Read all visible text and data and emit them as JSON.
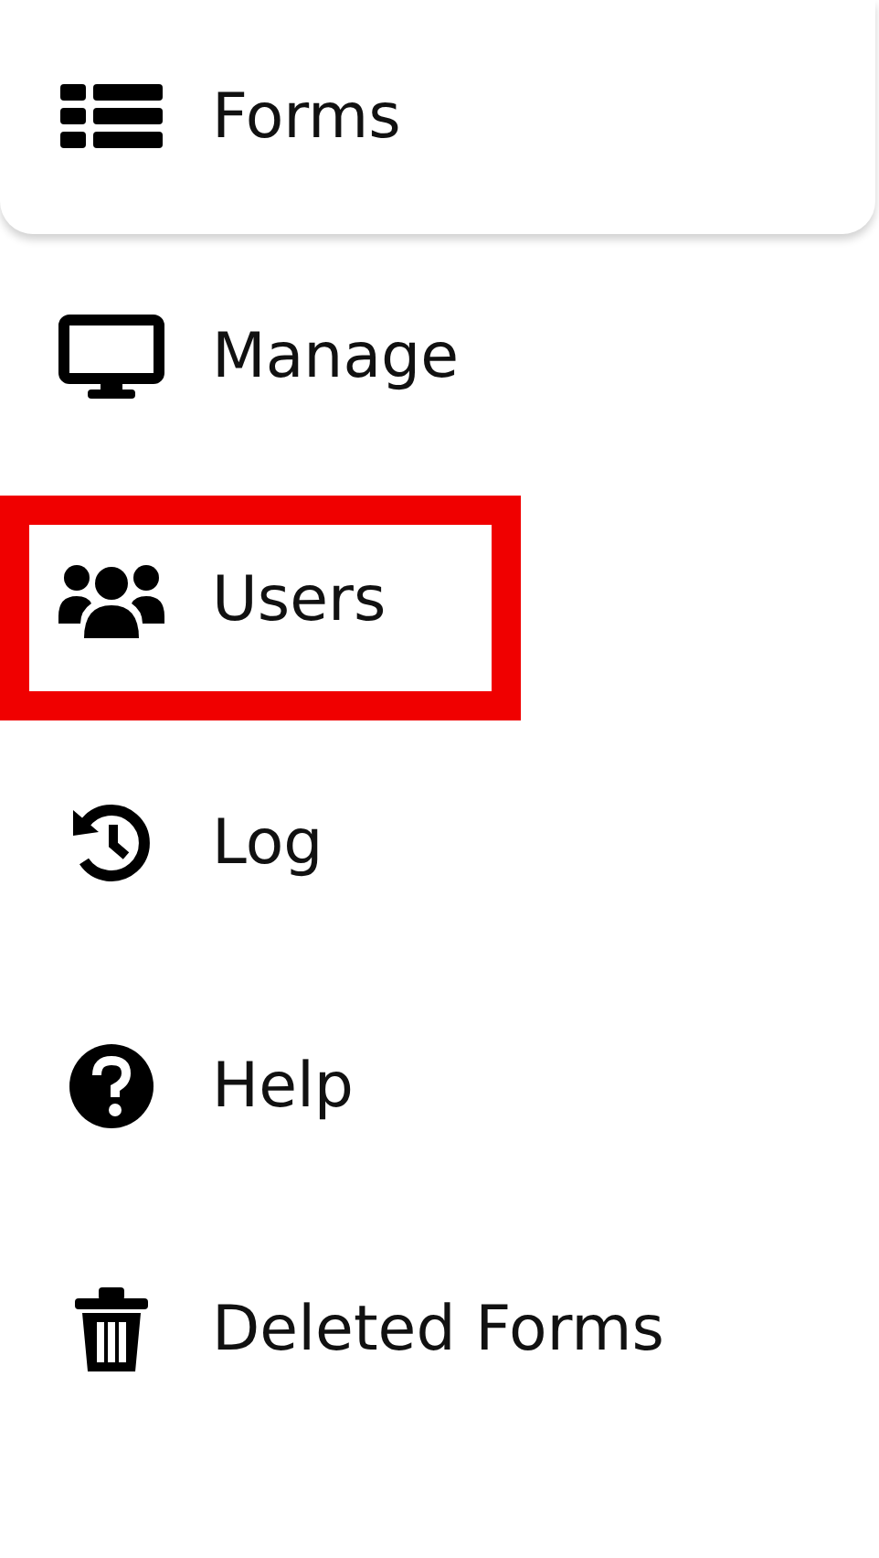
{
  "menu": {
    "items": [
      {
        "label": "Forms",
        "selected": true,
        "highlighted": false
      },
      {
        "label": "Manage",
        "selected": false,
        "highlighted": false
      },
      {
        "label": "Users",
        "selected": false,
        "highlighted": true
      },
      {
        "label": "Log",
        "selected": false,
        "highlighted": false
      },
      {
        "label": "Help",
        "selected": false,
        "highlighted": false
      },
      {
        "label": "Deleted Forms",
        "selected": false,
        "highlighted": false
      }
    ]
  }
}
